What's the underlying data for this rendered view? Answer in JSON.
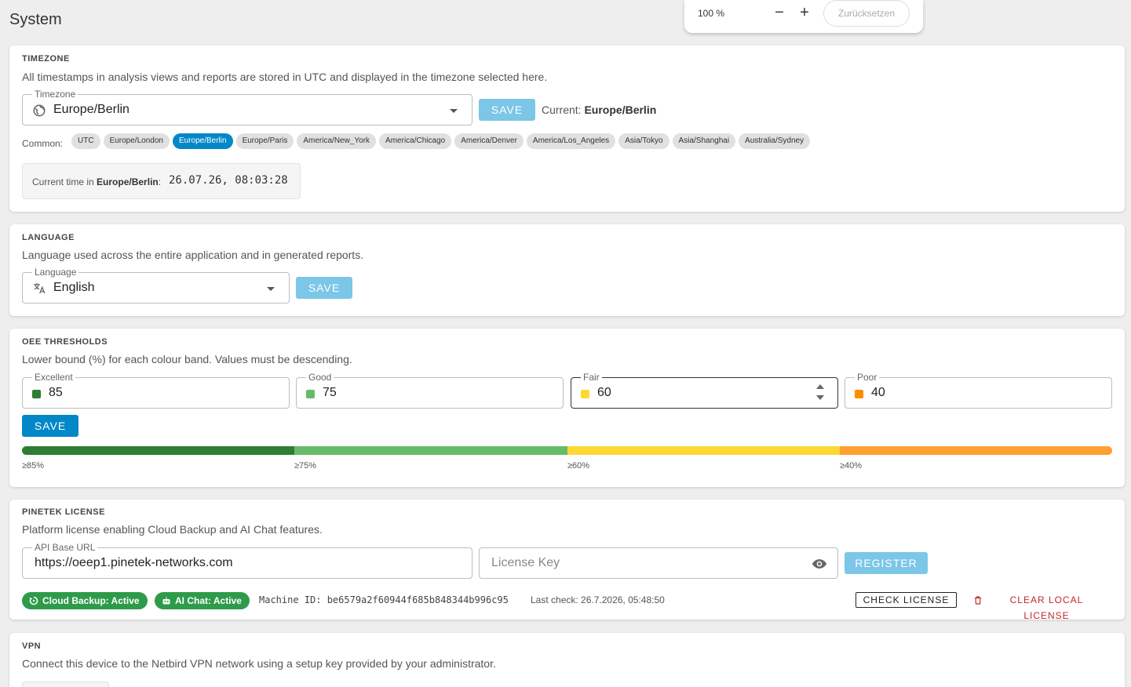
{
  "page": {
    "title": "System"
  },
  "zoom": {
    "percent": "100 %",
    "minus": "−",
    "plus": "+",
    "reset": "Zurücksetzen"
  },
  "timezone": {
    "title": "TIMEZONE",
    "description": "All timestamps in analysis views and reports are stored in UTC and displayed in the timezone selected here.",
    "field_label": "Timezone",
    "value": "Europe/Berlin",
    "save": "SAVE",
    "current_prefix": "Current:",
    "current_value": "Europe/Berlin",
    "common_label": "Common:",
    "chips": [
      "UTC",
      "Europe/London",
      "Europe/Berlin",
      "Europe/Paris",
      "America/New_York",
      "America/Chicago",
      "America/Denver",
      "America/Los_Angeles",
      "Asia/Tokyo",
      "Asia/Shanghai",
      "Australia/Sydney"
    ],
    "active_chip": "Europe/Berlin",
    "time_prefix": "Current time in",
    "time_zone": "Europe/Berlin",
    "time_value": "26.07.26, 08:03:28"
  },
  "language": {
    "title": "LANGUAGE",
    "description": "Language used across the entire application and in generated reports.",
    "field_label": "Language",
    "value": "English",
    "save": "SAVE"
  },
  "oee": {
    "title": "OEE THRESHOLDS",
    "description": "Lower bound (%) for each colour band. Values must be descending.",
    "fields": [
      {
        "label": "Excellent",
        "value": "85",
        "color": "#2e7d32"
      },
      {
        "label": "Good",
        "value": "75",
        "color": "#66bb6a"
      },
      {
        "label": "Fair",
        "value": "60",
        "color": "#fdd835"
      },
      {
        "label": "Poor",
        "value": "40",
        "color": "#fb8c00"
      }
    ],
    "save": "SAVE",
    "band_labels": [
      "≥85%",
      "≥75%",
      "≥60%",
      "≥40%"
    ]
  },
  "license": {
    "title": "PINETEK LICENSE",
    "description": "Platform license enabling Cloud Backup and AI Chat features.",
    "api_label": "API Base URL",
    "api_value": "https://oeep1.pinetek-networks.com",
    "key_placeholder": "License Key",
    "register": "REGISTER",
    "badge_backup": "Cloud Backup: Active",
    "badge_ai": "AI Chat: Active",
    "machine_id": "Machine ID: be6579a2f60944f685b848344b996c95",
    "last_check": "Last check: 26.7.2026, 05:48:50",
    "check": "CHECK LICENSE",
    "clear": "CLEAR LOCAL LICENSE"
  },
  "vpn": {
    "title": "VPN",
    "description": "Connect this device to the Netbird VPN network using a setup key provided by your administrator."
  }
}
